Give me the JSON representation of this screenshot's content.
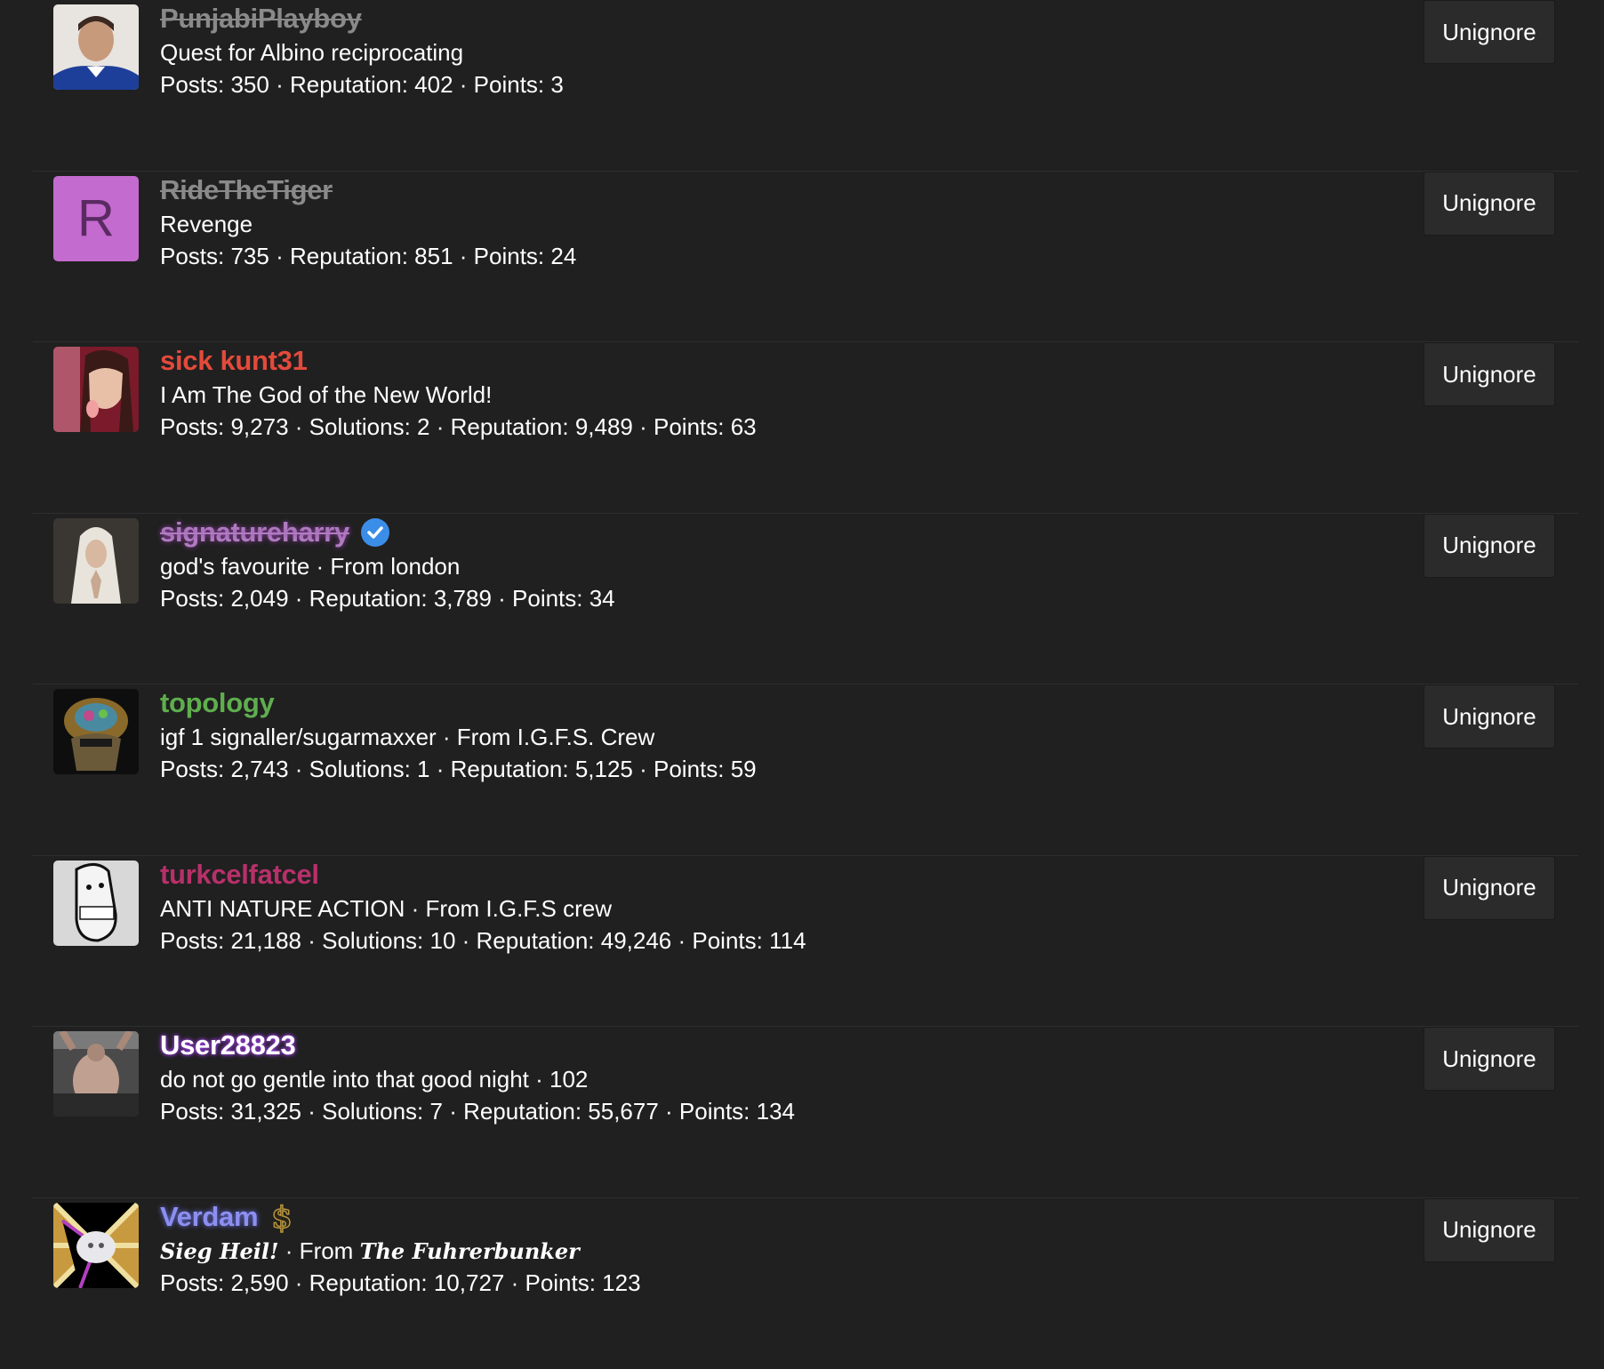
{
  "colors": {
    "background": "#202020",
    "button_bg": "#2b2b2b",
    "text": "#ffffff"
  },
  "unignore_label": "Unignore",
  "users": [
    {
      "username": "PunjabiPlayboy",
      "username_color": "#8a8a8a",
      "strikethrough": true,
      "tagline": "Quest for Albino reciprocating",
      "stats": "Posts: 350 · Reputation: 402 · Points: 3",
      "avatar": "photo-icon"
    },
    {
      "username": "RideTheTiger",
      "username_color": "#8a8a8a",
      "strikethrough": true,
      "tagline": "Revenge",
      "stats": "Posts: 735 · Reputation: 851 · Points: 24",
      "avatar_letter": "R",
      "avatar_color": "#c46bcf"
    },
    {
      "username": "sick kunt31",
      "username_color": "#e34a3b",
      "strikethrough": false,
      "tagline": "I Am The God of the New World!",
      "stats": "Posts: 9,273 · Solutions: 2 · Reputation: 9,489 · Points: 63",
      "avatar": "photo-icon"
    },
    {
      "username": "signatureharry",
      "username_color": "#b07cc0",
      "strikethrough": true,
      "badge": "verified-icon",
      "tagline": "god's favourite · From london",
      "stats": "Posts: 2,049 · Reputation: 3,789 · Points: 34",
      "avatar": "photo-icon"
    },
    {
      "username": "topology",
      "username_color": "#5fae4e",
      "strikethrough": false,
      "tagline": "igf 1 signaller/sugarmaxxer · From I.G.F.S. Crew",
      "stats": "Posts: 2,743 · Solutions: 1 · Reputation: 5,125 · Points: 59",
      "avatar": "photo-icon"
    },
    {
      "username": "turkcelfatcel",
      "username_color": "#b8306a",
      "strikethrough": false,
      "tagline": "ANTI NATURE ACTION · From I.G.F.S crew",
      "stats": "Posts: 21,188 · Solutions: 10 · Reputation: 49,246 · Points: 114",
      "avatar": "photo-icon"
    },
    {
      "username": "User28823",
      "username_color": "#ffffff",
      "username_glow": "#9b3fe0",
      "strikethrough": false,
      "tagline": "do not go gentle into that good night · 102",
      "stats": "Posts: 31,325 · Solutions: 7 · Reputation: 55,677 · Points: 134",
      "avatar": "photo-icon"
    },
    {
      "username": "Verdam",
      "username_color": "#8c8ff0",
      "username_glow": "#6a6fe0",
      "strikethrough": false,
      "badge": "dollar-icon",
      "tagline_part1": "Sieg Heil!",
      "tagline_sep": " · From ",
      "tagline_part2": "The Fuhrerbunker",
      "stats": "Posts: 2,590 · Reputation: 10,727 · Points: 123",
      "avatar": "photo-icon"
    }
  ]
}
